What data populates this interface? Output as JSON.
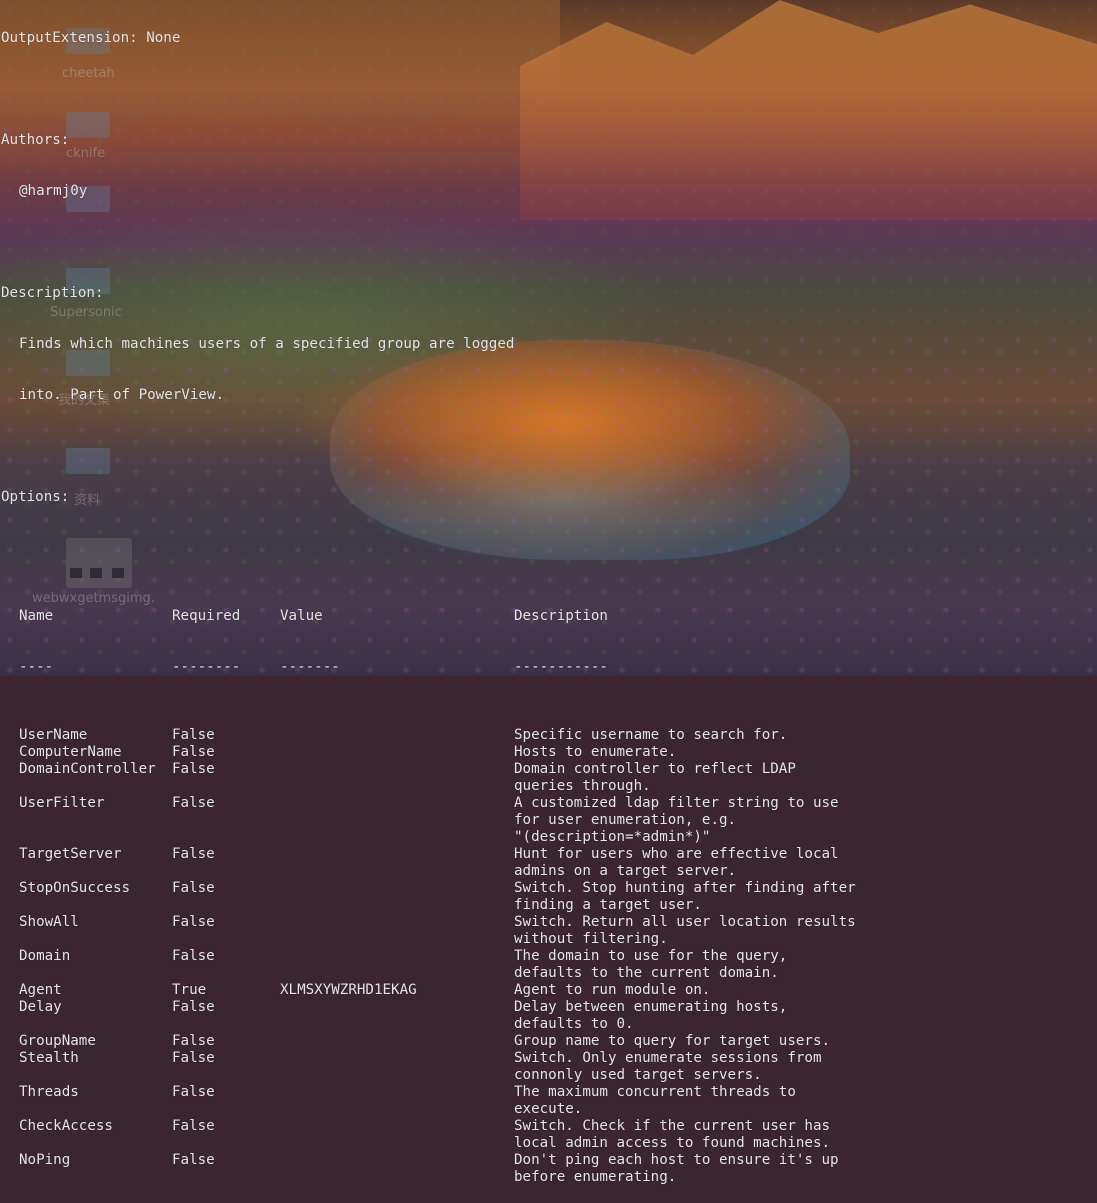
{
  "output_extension_line": "OutputExtension: None",
  "authors_label": "Authors:",
  "authors": [
    "@harmj0y"
  ],
  "description_label": "Description:",
  "description_lines": [
    "Finds which machines users of a specified group are logged",
    "into. Part of PowerView."
  ],
  "options_label": "Options:",
  "table": {
    "headers": {
      "name": "Name",
      "required": "Required",
      "value": "Value",
      "description": "Description"
    },
    "underlines": {
      "name": "----",
      "required": "--------",
      "value": "-------",
      "description": "-----------"
    },
    "rows": [
      {
        "name": "UserName",
        "required": "False",
        "value": "",
        "description": [
          "Specific username to search for."
        ]
      },
      {
        "name": "ComputerName",
        "required": "False",
        "value": "",
        "description": [
          "Hosts to enumerate."
        ]
      },
      {
        "name": "DomainController",
        "required": "False",
        "value": "",
        "description": [
          "Domain controller to reflect LDAP",
          "queries through."
        ]
      },
      {
        "name": "UserFilter",
        "required": "False",
        "value": "",
        "description": [
          "A customized ldap filter string to use",
          "for user enumeration, e.g.",
          "\"(description=*admin*)\""
        ]
      },
      {
        "name": "TargetServer",
        "required": "False",
        "value": "",
        "description": [
          "Hunt for users who are effective local",
          "admins on a target server."
        ]
      },
      {
        "name": "StopOnSuccess",
        "required": "False",
        "value": "",
        "description": [
          "Switch. Stop hunting after finding after",
          "finding a target user."
        ]
      },
      {
        "name": "ShowAll",
        "required": "False",
        "value": "",
        "description": [
          "Switch. Return all user location results",
          "without filtering."
        ]
      },
      {
        "name": "Domain",
        "required": "False",
        "value": "",
        "description": [
          "The domain to use for the query,",
          "defaults to the current domain."
        ]
      },
      {
        "name": "Agent",
        "required": "True",
        "value": "XLMSXYWZRHD1EKAG",
        "description": [
          "Agent to run module on."
        ]
      },
      {
        "name": "Delay",
        "required": "False",
        "value": "",
        "description": [
          "Delay between enumerating hosts,",
          "defaults to 0."
        ]
      },
      {
        "name": "GroupName",
        "required": "False",
        "value": "",
        "description": [
          "Group name to query for target users."
        ]
      },
      {
        "name": "Stealth",
        "required": "False",
        "value": "",
        "description": [
          "Switch. Only enumerate sessions from",
          "connonly used target servers."
        ]
      },
      {
        "name": "Threads",
        "required": "False",
        "value": "",
        "description": [
          "The maximum concurrent threads to",
          "execute."
        ]
      },
      {
        "name": "CheckAccess",
        "required": "False",
        "value": "",
        "description": [
          "Switch. Check if the current user has",
          "local admin access to found machines."
        ]
      },
      {
        "name": "NoPing",
        "required": "False",
        "value": "",
        "description": [
          "Don't ping each host to ensure it's up",
          "before enumerating."
        ]
      }
    ]
  },
  "desktop_labels": [
    "cheetah",
    "cknife",
    "Supersonic",
    "我的文集",
    "资料",
    "webwxgetmsgimg."
  ]
}
